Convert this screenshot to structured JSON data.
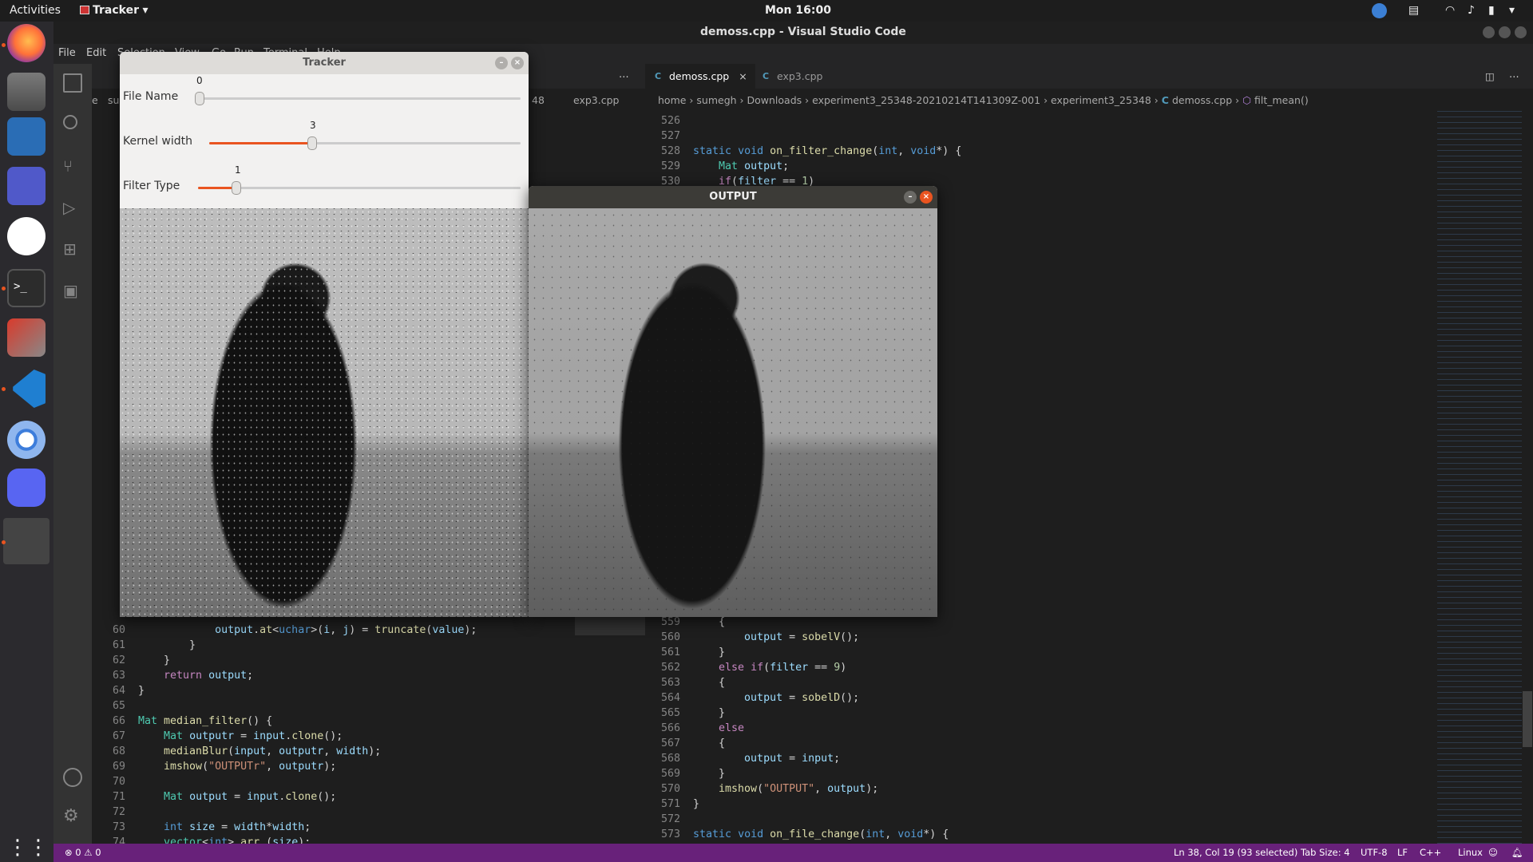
{
  "topbar": {
    "activities": "Activities",
    "app": "Tracker",
    "clock": "Mon 16:00"
  },
  "vscode": {
    "title": "demoss.cpp - Visual Studio Code",
    "menu": [
      "File",
      "Edit",
      "Selection",
      "View",
      "Go",
      "Run",
      "Terminal",
      "Help"
    ],
    "left_group": {
      "breadcrumb": [
        "e",
        "su",
        "48",
        "exp3.cpp"
      ],
      "code": [
        {
          "n": "60",
          "html": "            <span class='var'>output</span>.<span class='fn'>at</span>&lt;<span class='kw'>uchar</span>&gt;(<span class='var'>i</span>, <span class='var'>j</span>) = <span class='fn'>truncate</span>(<span class='var'>value</span>);"
        },
        {
          "n": "61",
          "html": "        }"
        },
        {
          "n": "62",
          "html": "    }"
        },
        {
          "n": "63",
          "html": "    <span class='ctl'>return</span> <span class='var'>output</span>;"
        },
        {
          "n": "64",
          "html": "}"
        },
        {
          "n": "65",
          "html": ""
        },
        {
          "n": "66",
          "html": "<span class='ty'>Mat</span> <span class='fn'>median_filter</span>() {"
        },
        {
          "n": "67",
          "html": "    <span class='ty'>Mat</span> <span class='var'>outputr</span> = <span class='var'>input</span>.<span class='fn'>clone</span>();"
        },
        {
          "n": "68",
          "html": "    <span class='fn'>medianBlur</span>(<span class='var'>input</span>, <span class='var'>outputr</span>, <span class='var'>width</span>);"
        },
        {
          "n": "69",
          "html": "    <span class='fn'>imshow</span>(<span class='str'>\"OUTPUTr\"</span>, <span class='var'>outputr</span>);"
        },
        {
          "n": "70",
          "html": ""
        },
        {
          "n": "71",
          "html": "    <span class='ty'>Mat</span> <span class='var'>output</span> = <span class='var'>input</span>.<span class='fn'>clone</span>();"
        },
        {
          "n": "72",
          "html": ""
        },
        {
          "n": "73",
          "html": "    <span class='kw'>int</span> <span class='var'>size</span> = <span class='var'>width</span>*<span class='var'>width</span>;"
        },
        {
          "n": "74",
          "html": "    <span class='ty'>vector</span>&lt;<span class='kw'>int</span>&gt; <span class='fn'>arr</span> (<span class='var'>size</span>);"
        }
      ]
    },
    "right_group": {
      "tabs": [
        {
          "label": "demoss.cpp"
        },
        {
          "label": "exp3.cpp"
        }
      ],
      "breadcrumb": [
        "home",
        "sumegh",
        "Downloads",
        "experiment3_25348-20210214T141309Z-001",
        "experiment3_25348",
        "demoss.cpp",
        "filt_mean()"
      ],
      "code_top": [
        {
          "n": "526",
          "html": ""
        },
        {
          "n": "527",
          "html": ""
        },
        {
          "n": "528",
          "html": "<span class='kw'>static</span> <span class='kw'>void</span> <span class='fn'>on_filter_change</span>(<span class='kw'>int</span>, <span class='kw'>void</span>*) {"
        },
        {
          "n": "529",
          "html": "    <span class='ty'>Mat</span> <span class='var'>output</span>;"
        },
        {
          "n": "530",
          "html": "    <span class='ctl'>if</span>(<span class='var'>filter</span> == <span class='num'>1</span>)"
        }
      ],
      "code_bottom": [
        {
          "n": "559",
          "html": "    {"
        },
        {
          "n": "560",
          "html": "        <span class='var'>output</span> = <span class='fn'>sobelV</span>();"
        },
        {
          "n": "561",
          "html": "    }"
        },
        {
          "n": "562",
          "html": "    <span class='ctl'>else</span> <span class='ctl'>if</span>(<span class='var'>filter</span> == <span class='num'>9</span>)"
        },
        {
          "n": "563",
          "html": "    {"
        },
        {
          "n": "564",
          "html": "        <span class='var'>output</span> = <span class='fn'>sobelD</span>();"
        },
        {
          "n": "565",
          "html": "    }"
        },
        {
          "n": "566",
          "html": "    <span class='ctl'>else</span>"
        },
        {
          "n": "567",
          "html": "    {"
        },
        {
          "n": "568",
          "html": "        <span class='var'>output</span> = <span class='var'>input</span>;"
        },
        {
          "n": "569",
          "html": "    }"
        },
        {
          "n": "570",
          "html": "    <span class='fn'>imshow</span>(<span class='str'>\"OUTPUT\"</span>, <span class='var'>output</span>);"
        },
        {
          "n": "571",
          "html": "}"
        },
        {
          "n": "572",
          "html": ""
        },
        {
          "n": "573",
          "html": "<span class='kw'>static</span> <span class='kw'>void</span> <span class='fn'>on_file_change</span>(<span class='kw'>int</span>, <span class='kw'>void</span>*) {"
        }
      ]
    },
    "status": {
      "problems": "⊗ 0 ⚠ 0",
      "position": "Ln 38, Col 19 (93 selected)",
      "tabsize": "Tab Size: 4",
      "encoding": "UTF-8",
      "eol": "LF",
      "lang": "C++",
      "os": "Linux"
    }
  },
  "tracker": {
    "title": "Tracker",
    "sliders": [
      {
        "label": "File Name",
        "value": "0",
        "fraction": 0.0
      },
      {
        "label": "Kernel width",
        "value": "3",
        "fraction": 0.33
      },
      {
        "label": "Filter Type",
        "value": "1",
        "fraction": 0.12
      }
    ]
  },
  "output": {
    "title": "OUTPUT"
  }
}
